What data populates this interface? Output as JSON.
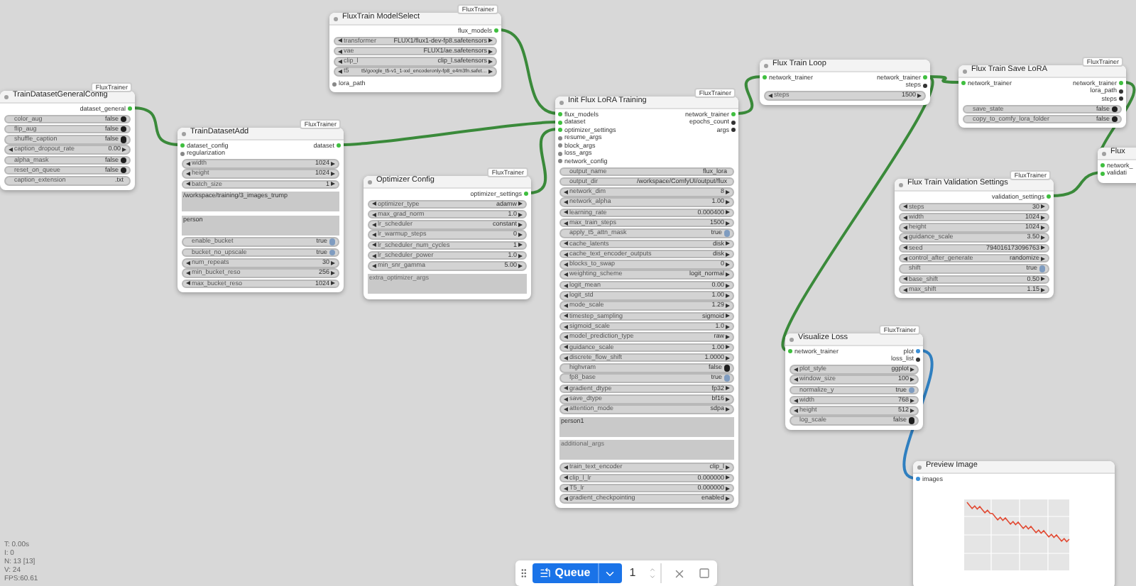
{
  "nodes": [
    {
      "title": "TrainDatasetGeneralConfig",
      "badge": "FluxTrainer",
      "outputs": [
        {
          "label": "dataset_general",
          "color": "#3fbf3f"
        }
      ],
      "widgets": [
        {
          "kind": "toggle",
          "label": "color_aug",
          "value": "false",
          "on": false
        },
        {
          "kind": "toggle",
          "label": "flip_aug",
          "value": "false",
          "on": false
        },
        {
          "kind": "toggle",
          "label": "shuffle_caption",
          "value": "false",
          "on": false
        },
        {
          "kind": "stepper",
          "label": "caption_dropout_rate",
          "value": "0.00"
        },
        {
          "kind": "toggle",
          "label": "alpha_mask",
          "value": "false",
          "on": false
        },
        {
          "kind": "toggle",
          "label": "reset_on_queue",
          "value": "false",
          "on": false
        },
        {
          "kind": "text",
          "label": "caption_extension",
          "value": ".txt"
        }
      ]
    },
    {
      "title": "TrainDatasetAdd",
      "badge": "FluxTrainer",
      "inputs": [
        {
          "label": "dataset_config",
          "color": "#3fbf3f"
        },
        {
          "label": "regularization",
          "color": "#888888"
        }
      ],
      "outputs": [
        {
          "label": "dataset",
          "color": "#3fbf3f"
        }
      ],
      "widgets": [
        {
          "kind": "stepper",
          "label": "width",
          "value": "1024"
        },
        {
          "kind": "stepper",
          "label": "height",
          "value": "1024"
        },
        {
          "kind": "stepper",
          "label": "batch_size",
          "value": "1"
        },
        {
          "kind": "textarea",
          "value": "/workspace/training/3_images_trump"
        },
        {
          "kind": "textarea",
          "value": "person"
        },
        {
          "kind": "toggle",
          "label": "enable_bucket",
          "value": "true",
          "on": true
        },
        {
          "kind": "toggle",
          "label": "bucket_no_upscale",
          "value": "true",
          "on": true
        },
        {
          "kind": "stepper",
          "label": "num_repeats",
          "value": "30"
        },
        {
          "kind": "stepper",
          "label": "min_bucket_reso",
          "value": "256"
        },
        {
          "kind": "stepper",
          "label": "max_bucket_reso",
          "value": "1024"
        }
      ]
    },
    {
      "title": "FluxTrain ModelSelect",
      "badge": "FluxTrainer",
      "outputs": [
        {
          "label": "flux_models",
          "color": "#3fbf3f"
        }
      ],
      "widgets": [
        {
          "kind": "stepper",
          "label": "transformer",
          "value": "FLUX1/flux1-dev-fp8.safetensors"
        },
        {
          "kind": "stepper",
          "label": "vae",
          "value": "FLUX1/ae.safetensors"
        },
        {
          "kind": "stepper",
          "label": "clip_l",
          "value": "clip_l.safetensors"
        },
        {
          "kind": "stepper",
          "label": "t5",
          "value": "t5/google_t5-v1_1-xxl_encoderonly-fp8_e4m3fn.safet…"
        }
      ],
      "trailing_inputs": [
        {
          "label": "lora_path",
          "color": "#888888"
        }
      ]
    },
    {
      "title": "Optimizer Config",
      "badge": "FluxTrainer",
      "outputs": [
        {
          "label": "optimizer_settings",
          "color": "#3fbf3f"
        }
      ],
      "widgets": [
        {
          "kind": "stepper",
          "label": "optimizer_type",
          "value": "adamw"
        },
        {
          "kind": "stepper",
          "label": "max_grad_norm",
          "value": "1.0"
        },
        {
          "kind": "stepper",
          "label": "lr_scheduler",
          "value": "constant"
        },
        {
          "kind": "stepper",
          "label": "lr_warmup_steps",
          "value": "0"
        },
        {
          "kind": "stepper",
          "label": "lr_scheduler_num_cycles",
          "value": "1"
        },
        {
          "kind": "stepper",
          "label": "lr_scheduler_power",
          "value": "1.0"
        },
        {
          "kind": "stepper",
          "label": "min_snr_gamma",
          "value": "5.00"
        },
        {
          "kind": "textarea",
          "placeholder": "extra_optimizer_args"
        }
      ]
    },
    {
      "title": "Init Flux LoRA Training",
      "badge": "FluxTrainer",
      "inputs": [
        {
          "label": "flux_models",
          "color": "#3fbf3f"
        },
        {
          "label": "dataset",
          "color": "#3fbf3f"
        },
        {
          "label": "optimizer_settings",
          "color": "#3fbf3f"
        },
        {
          "label": "resume_args",
          "color": "#888888"
        },
        {
          "label": "block_args",
          "color": "#888888"
        },
        {
          "label": "loss_args",
          "color": "#888888"
        },
        {
          "label": "network_config",
          "color": "#888888"
        }
      ],
      "outputs": [
        {
          "label": "network_trainer",
          "color": "#3fbf3f"
        },
        {
          "label": "epochs_count",
          "color": "#333333"
        },
        {
          "label": "args",
          "color": "#333333"
        }
      ],
      "widgets": [
        {
          "kind": "text",
          "label": "output_name",
          "value": "flux_lora"
        },
        {
          "kind": "text",
          "label": "output_dir",
          "value": "/workspace/ComfyUI/output/flux"
        },
        {
          "kind": "stepper",
          "label": "network_dim",
          "value": "8"
        },
        {
          "kind": "stepper",
          "label": "network_alpha",
          "value": "1.00"
        },
        {
          "kind": "stepper",
          "label": "learning_rate",
          "value": "0.000400"
        },
        {
          "kind": "stepper",
          "label": "max_train_steps",
          "value": "1500"
        },
        {
          "kind": "toggle",
          "label": "apply_t5_attn_mask",
          "value": "true",
          "on": true
        },
        {
          "kind": "stepper",
          "label": "cache_latents",
          "value": "disk"
        },
        {
          "kind": "stepper",
          "label": "cache_text_encoder_outputs",
          "value": "disk"
        },
        {
          "kind": "stepper",
          "label": "blocks_to_swap",
          "value": "0"
        },
        {
          "kind": "stepper",
          "label": "weighting_scheme",
          "value": "logit_normal"
        },
        {
          "kind": "stepper",
          "label": "logit_mean",
          "value": "0.00"
        },
        {
          "kind": "stepper",
          "label": "logit_std",
          "value": "1.00"
        },
        {
          "kind": "stepper",
          "label": "mode_scale",
          "value": "1.29"
        },
        {
          "kind": "stepper",
          "label": "timestep_sampling",
          "value": "sigmoid"
        },
        {
          "kind": "stepper",
          "label": "sigmoid_scale",
          "value": "1.0"
        },
        {
          "kind": "stepper",
          "label": "model_prediction_type",
          "value": "raw"
        },
        {
          "kind": "stepper",
          "label": "guidance_scale",
          "value": "1.00"
        },
        {
          "kind": "stepper",
          "label": "discrete_flow_shift",
          "value": "1.0000"
        },
        {
          "kind": "toggle",
          "label": "highvram",
          "value": "false",
          "on": false
        },
        {
          "kind": "toggle",
          "label": "fp8_base",
          "value": "true",
          "on": true
        },
        {
          "kind": "stepper",
          "label": "gradient_dtype",
          "value": "fp32"
        },
        {
          "kind": "stepper",
          "label": "save_dtype",
          "value": "bf16"
        },
        {
          "kind": "stepper",
          "label": "attention_mode",
          "value": "sdpa"
        },
        {
          "kind": "textarea",
          "value": "person1"
        },
        {
          "kind": "textarea",
          "placeholder": "additional_args"
        },
        {
          "kind": "stepper",
          "label": "train_text_encoder",
          "value": "clip_l"
        },
        {
          "kind": "stepper",
          "label": "clip_l_lr",
          "value": "0.000000"
        },
        {
          "kind": "stepper",
          "label": "T5_lr",
          "value": "0.000000"
        },
        {
          "kind": "stepper",
          "label": "gradient_checkpointing",
          "value": "enabled"
        }
      ]
    },
    {
      "title": "Flux Train Loop",
      "inputs": [
        {
          "label": "network_trainer",
          "color": "#3fbf3f"
        }
      ],
      "outputs": [
        {
          "label": "network_trainer",
          "color": "#3fbf3f"
        },
        {
          "label": "steps",
          "color": "#333333"
        }
      ],
      "widgets": [
        {
          "kind": "stepper",
          "label": "steps",
          "value": "1500"
        }
      ]
    },
    {
      "title": "Flux Train Save LoRA",
      "badge": "FluxTrainer",
      "inputs": [
        {
          "label": "network_trainer",
          "color": "#3fbf3f"
        }
      ],
      "outputs": [
        {
          "label": "network_trainer",
          "color": "#3fbf3f"
        },
        {
          "label": "lora_path",
          "color": "#333333"
        },
        {
          "label": "steps",
          "color": "#333333"
        }
      ],
      "widgets": [
        {
          "kind": "toggle",
          "label": "save_state",
          "value": "false",
          "on": false
        },
        {
          "kind": "toggle",
          "label": "copy_to_comfy_lora_folder",
          "value": "false",
          "on": false
        }
      ]
    },
    {
      "title": "Flux Train Validation Settings",
      "badge": "FluxTrainer",
      "outputs": [
        {
          "label": "validation_settings",
          "color": "#3fbf3f"
        }
      ],
      "widgets": [
        {
          "kind": "stepper",
          "label": "steps",
          "value": "30"
        },
        {
          "kind": "stepper",
          "label": "width",
          "value": "1024"
        },
        {
          "kind": "stepper",
          "label": "height",
          "value": "1024"
        },
        {
          "kind": "stepper",
          "label": "guidance_scale",
          "value": "3.50"
        },
        {
          "kind": "stepper",
          "label": "seed",
          "value": "794016173096763"
        },
        {
          "kind": "stepper",
          "label": "control_after_generate",
          "value": "randomize"
        },
        {
          "kind": "toggle",
          "label": "shift",
          "value": "true",
          "on": true
        },
        {
          "kind": "stepper",
          "label": "base_shift",
          "value": "0.50"
        },
        {
          "kind": "stepper",
          "label": "max_shift",
          "value": "1.15"
        }
      ]
    },
    {
      "title": "Flux",
      "inputs": [
        {
          "label": "network_",
          "color": "#3fbf3f"
        },
        {
          "label": "validati",
          "color": "#3fbf3f"
        }
      ]
    },
    {
      "title": "Visualize Loss",
      "badge": "FluxTrainer",
      "inputs": [
        {
          "label": "network_trainer",
          "color": "#3fbf3f"
        }
      ],
      "outputs": [
        {
          "label": "plot",
          "color": "#3b8fd6"
        },
        {
          "label": "loss_list",
          "color": "#333333"
        }
      ],
      "widgets": [
        {
          "kind": "stepper",
          "label": "plot_style",
          "value": "ggplot"
        },
        {
          "kind": "stepper",
          "label": "window_size",
          "value": "100"
        },
        {
          "kind": "toggle",
          "label": "normalize_y",
          "value": "true",
          "on": true
        },
        {
          "kind": "stepper",
          "label": "width",
          "value": "768"
        },
        {
          "kind": "stepper",
          "label": "height",
          "value": "512"
        },
        {
          "kind": "toggle",
          "label": "log_scale",
          "value": "false",
          "on": false
        }
      ]
    },
    {
      "title": "Preview Image",
      "inputs": [
        {
          "label": "images",
          "color": "#3b8fd6"
        }
      ],
      "widgets": [
        {
          "kind": "image"
        }
      ]
    }
  ],
  "stats": [
    "T: 0.00s",
    "I: 0",
    "N: 13 [13]",
    "V: 24",
    "FPS:60.61"
  ],
  "toolbar": {
    "queue_label": "Queue",
    "batch_count": "1"
  }
}
